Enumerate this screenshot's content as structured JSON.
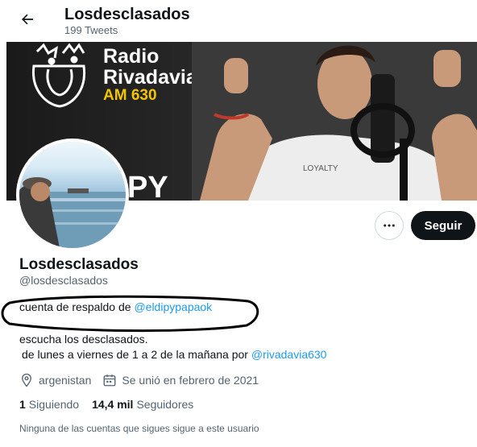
{
  "header": {
    "title": "Losdesclasados",
    "tweet_count": "199 Tweets"
  },
  "banner": {
    "logo_line1": "Radio",
    "logo_line2": "Rivadavia",
    "logo_line3": "AM 630",
    "partial_text": "PY",
    "shirt_text": "LOYALTY"
  },
  "actions": {
    "follow_label": "Seguir",
    "more_label": "···"
  },
  "profile": {
    "name": "Losdesclasados",
    "handle": "@losdesclasados",
    "bio_line1_text": "cuenta de respaldo de ",
    "bio_line1_mention": "@eldipypapaok",
    "bio_line2": "escucha los desclasados.",
    "bio_line3_text": "de lunes a viernes de 1 a 2 de la mañana por ",
    "bio_line3_mention": "@rivadavia630",
    "location": "argenistan",
    "joined": "Se unió en febrero de 2021"
  },
  "stats": {
    "following_count": "1",
    "following_label": "Siguiendo",
    "followers_count": "14,4 mil",
    "followers_label": "Seguidores"
  },
  "notice": "Ninguna de las cuentas que sigues sigue a este usuario",
  "colors": {
    "link": "#1d9bf0",
    "text": "#0f1419",
    "secondary": "#536471",
    "accent_yellow": "#f5c400"
  }
}
